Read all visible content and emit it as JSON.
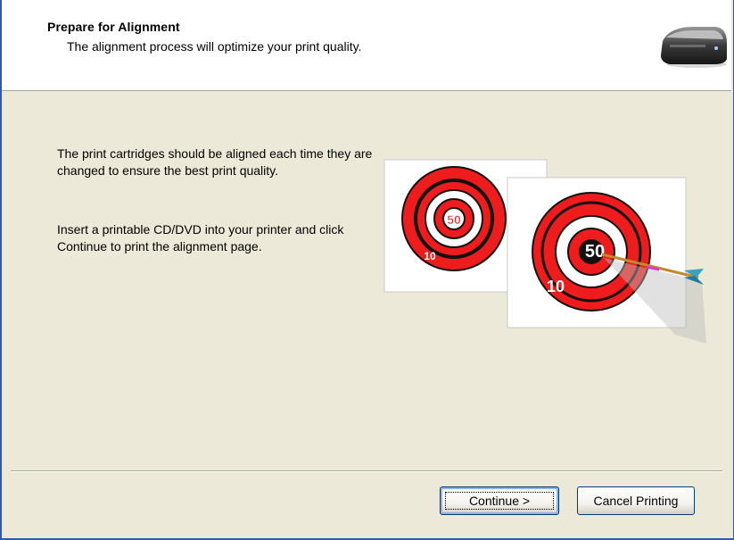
{
  "header": {
    "title": "Prepare for Alignment",
    "subtitle": "The alignment process will optimize your print quality.",
    "icon": "printer-icon"
  },
  "body": {
    "paragraph1": "The print cartridges should be aligned each time they are changed to ensure the best print quality.",
    "paragraph2": "Insert a printable CD/DVD into your printer and click Continue to print the alignment page."
  },
  "illustration": {
    "target_small_center_label": "50",
    "target_small_outer_label": "10",
    "target_large_center_label": "50",
    "target_large_outer_label": "10"
  },
  "buttons": {
    "continue_label": "Continue >",
    "cancel_label": "Cancel Printing"
  },
  "colors": {
    "window_border": "#2a59b8",
    "dialog_background": "#ece9d8",
    "target_red": "#ee1c1c",
    "button_border": "#003c74"
  }
}
